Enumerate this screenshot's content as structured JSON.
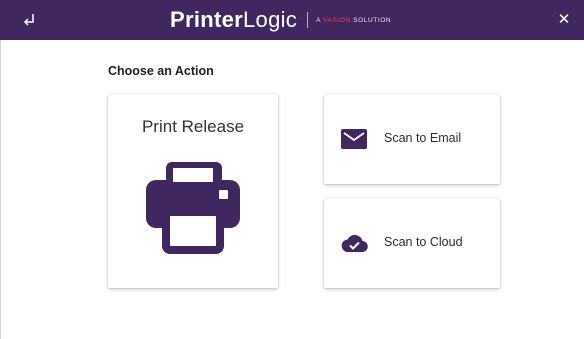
{
  "topbar": {
    "back_icon": "return-arrow-icon",
    "close_label": "✕",
    "brand": {
      "printer": "Printer",
      "logic": "Logic",
      "tagline_prefix": "A ",
      "tagline_accent": "VASION",
      "tagline_suffix": " SOLUTION"
    },
    "background": "#41275f"
  },
  "main": {
    "heading": "Choose an Action",
    "cards": {
      "print_release": {
        "label": "Print Release",
        "icon": "printer-icon"
      },
      "scan_email": {
        "label": "Scan to Email",
        "icon": "envelope-icon"
      },
      "scan_cloud": {
        "label": "Scan to Cloud",
        "icon": "cloud-check-icon"
      }
    },
    "icon_color": "#41275f"
  }
}
